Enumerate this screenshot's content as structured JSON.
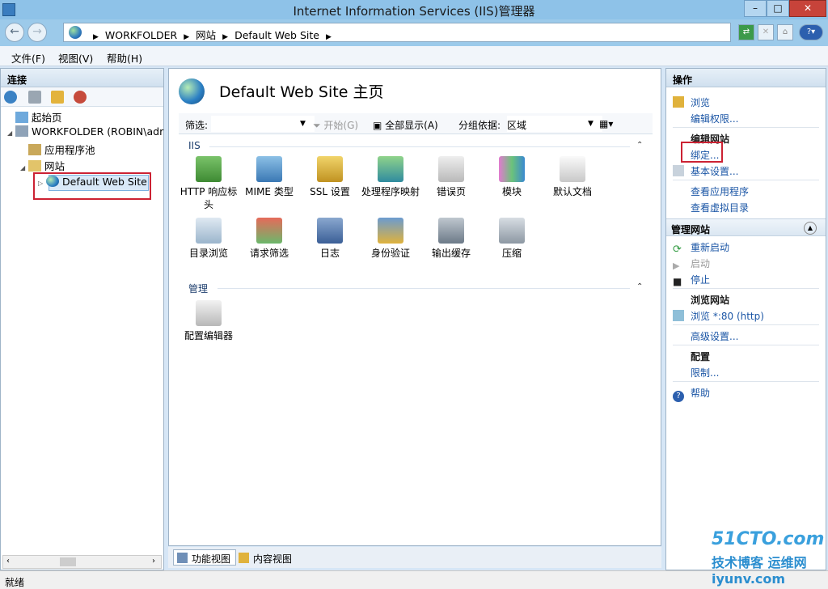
{
  "window": {
    "title": "Internet Information Services (IIS)管理器"
  },
  "address": {
    "crumbs": [
      "WORKFOLDER",
      "网站",
      "Default Web Site"
    ]
  },
  "menu": [
    "文件(F)",
    "视图(V)",
    "帮助(H)"
  ],
  "left": {
    "header": "连接",
    "tree": {
      "start_page": "起始页",
      "server": "WORKFOLDER (ROBIN\\adr",
      "app_pools": "应用程序池",
      "sites": "网站",
      "default_site": "Default Web Site"
    }
  },
  "center": {
    "title": "Default Web Site 主页",
    "filter": {
      "label": "筛选:",
      "start": "开始(G)",
      "show_all": "全部显示(A)",
      "group_by": "分组依据:",
      "group_value": "区域"
    },
    "groups": {
      "iis": {
        "label": "IIS",
        "items": [
          "HTTP 响应标头",
          "MIME 类型",
          "SSL 设置",
          "处理程序映射",
          "错误页",
          "模块",
          "默认文档",
          "目录浏览",
          "请求筛选",
          "日志",
          "身份验证",
          "输出缓存",
          "压缩"
        ]
      },
      "manage": {
        "label": "管理",
        "items": [
          "配置编辑器"
        ]
      }
    },
    "footer": {
      "features_view": "功能视图",
      "content_view": "内容视图"
    }
  },
  "right": {
    "header": "操作",
    "actions": {
      "browse": "浏览",
      "edit_perms": "编辑权限...",
      "edit_site": "编辑网站",
      "bindings": "绑定...",
      "basic_settings": "基本设置...",
      "view_apps": "查看应用程序",
      "view_vdirs": "查看虚拟目录",
      "manage_site": "管理网站",
      "restart": "重新启动",
      "start": "启动",
      "stop": "停止",
      "browse_site": "浏览网站",
      "browse_80": "浏览 *:80 (http)",
      "advanced": "高级设置...",
      "config": "配置",
      "limits": "限制...",
      "help": "帮助"
    }
  },
  "status": {
    "text": "就绪"
  },
  "watermark": {
    "line1": "51CTO.com",
    "line2": "技术博客 运维网 iyunv.com"
  },
  "colors": {
    "highlight_red": "#cc2233",
    "link_blue": "#1a55a5",
    "title_bar": "#8ec2e8"
  },
  "icons": [
    "globe-icon",
    "back-arrow-icon",
    "forward-arrow-icon",
    "refresh-icon",
    "help-icon"
  ]
}
